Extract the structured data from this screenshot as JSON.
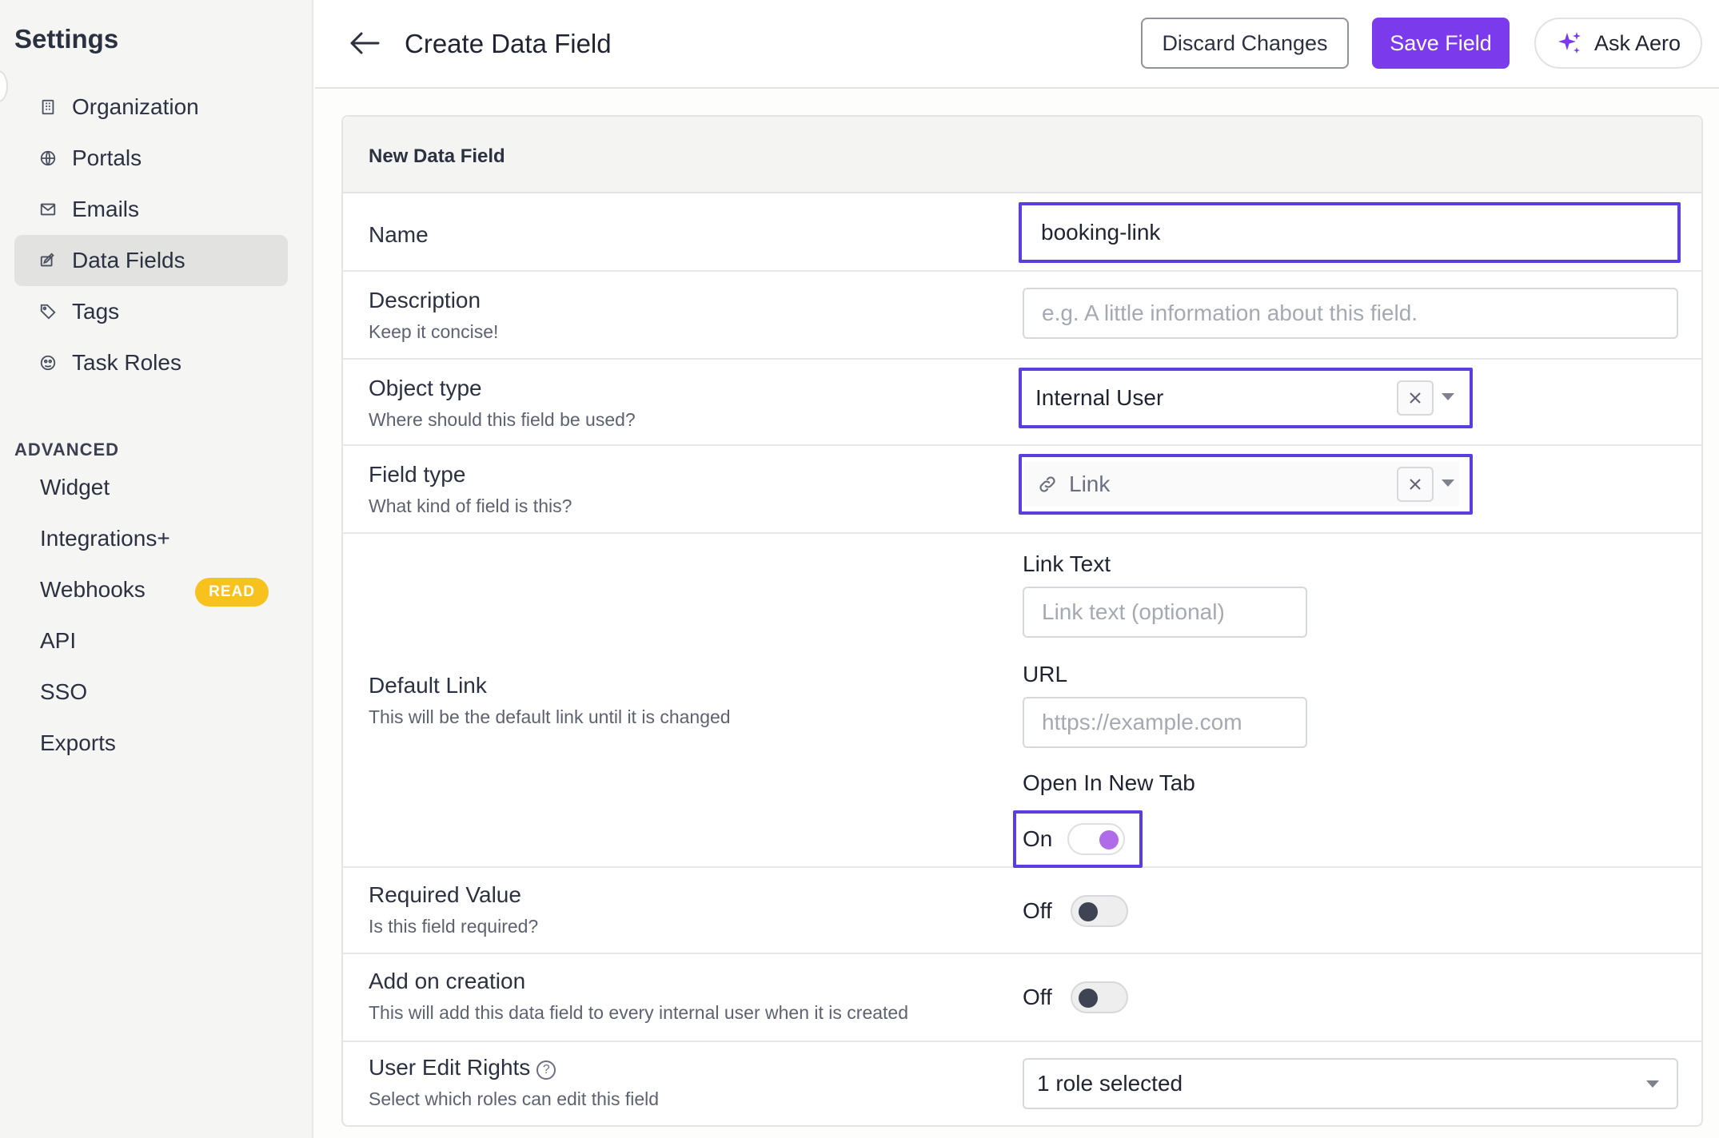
{
  "sidebar": {
    "title": "Settings",
    "items": [
      {
        "label": "Organization",
        "icon": "building-icon"
      },
      {
        "label": "Portals",
        "icon": "globe-icon"
      },
      {
        "label": "Emails",
        "icon": "mail-icon"
      },
      {
        "label": "Data Fields",
        "icon": "edit-field-icon",
        "active": true
      },
      {
        "label": "Tags",
        "icon": "tag-icon"
      },
      {
        "label": "Task Roles",
        "icon": "roles-icon"
      }
    ],
    "advanced_label": "ADVANCED",
    "advanced_items": [
      {
        "label": "Widget"
      },
      {
        "label": "Integrations+"
      },
      {
        "label": "Webhooks",
        "badge": "READ"
      },
      {
        "label": "API"
      },
      {
        "label": "SSO"
      },
      {
        "label": "Exports"
      }
    ]
  },
  "header": {
    "back_icon": "arrow-left-icon",
    "title": "Create Data Field",
    "discard_label": "Discard Changes",
    "save_label": "Save Field",
    "ask_label": "Ask Aero",
    "ask_icon": "sparkle-icon"
  },
  "form": {
    "card_title": "New Data Field",
    "name": {
      "label": "Name",
      "value": "booking-link"
    },
    "description": {
      "label": "Description",
      "sub": "Keep it concise!",
      "placeholder": "e.g. A little information about this field."
    },
    "object_type": {
      "label": "Object type",
      "sub": "Where should this field be used?",
      "value": "Internal User"
    },
    "field_type": {
      "label": "Field type",
      "sub": "What kind of field is this?",
      "value": "Link",
      "icon": "link-icon"
    },
    "default_link": {
      "label": "Default Link",
      "sub": "This will be the default link until it is changed",
      "link_text_label": "Link Text",
      "link_text_placeholder": "Link text (optional)",
      "url_label": "URL",
      "url_placeholder": "https://example.com",
      "new_tab_label": "Open In New Tab",
      "new_tab_state": "On"
    },
    "required": {
      "label": "Required Value",
      "sub": "Is this field required?",
      "state": "Off"
    },
    "add_on_creation": {
      "label": "Add on creation",
      "sub": "This will add this data field to every internal user when it is created",
      "state": "Off"
    },
    "edit_rights": {
      "label": "User Edit Rights",
      "sub": "Select which roles can edit this field",
      "value": "1 role selected",
      "help_glyph": "?"
    }
  },
  "colors": {
    "accent": "#7c3aed",
    "focus": "#5b3de0",
    "badge": "#f7c21e",
    "toggle_on": "#b06be8"
  }
}
